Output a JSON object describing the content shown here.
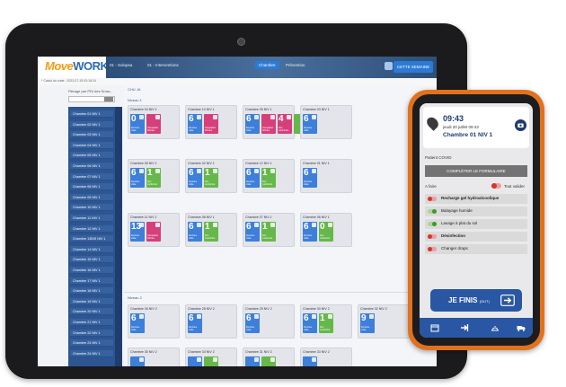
{
  "tablet": {
    "logo_move": "Move",
    "logo_work": "WORK",
    "logo_sub": "",
    "nav": [
      {
        "label": "01 - Solopsa"
      },
      {
        "label": "01 - Interventions"
      },
      {
        "label": "Chambre",
        "active": true
      },
      {
        "label": "Prévention"
      }
    ],
    "week_button": "CETTE SEMAINE",
    "calc_text": "* Calcul du cube : 2023-07-15 03:15:24",
    "filter_label": "Filtrage par PDI des Smar...",
    "sidebar_rooms": [
      "Chambre 01 NIV 1",
      "Chambre 02 NIV 1",
      "Chambre 03 NIV 1",
      "Chambre 04 NIV 1",
      "Chambre 05 NIV 1",
      "Chambre 06 NIV 1",
      "Chambre 07 NIV 1",
      "Chambre 08 NIV 1",
      "Chambre 09 NIV 1",
      "Chambre 10 NIV 1",
      "Chambre 11 NIV 1",
      "Chambre 12 NIV 1",
      "Chambre 13BIS NIV 1",
      "Chambre 14 NIV 1",
      "Chambre 15 NIV 1",
      "Chambre 16 NIV 1",
      "Chambre 17 NIV 1",
      "Chambre 18 NIV 1",
      "Chambre 19 NIV 1",
      "Chambre 20 NIV 1",
      "Chambre 21 NIV 1",
      "Chambre 22 NIV 1",
      "Chambre 23 NIV 1",
      "Chambre 24 NIV 1"
    ],
    "breadcrumb": "CHU JA",
    "niveau1": "Niveau 1",
    "niveau2": "Niveau 2",
    "cards": [
      {
        "title": "Chambre 04 NIV 1",
        "tiles": [
          {
            "n": "0",
            "c": "blue",
            "l": "Dernière visite"
          },
          {
            "n": "",
            "c": "pink",
            "l": "Occupation DirCare"
          }
        ]
      },
      {
        "title": "Chambre 10 NIV 1",
        "tiles": [
          {
            "n": "6",
            "c": "blue",
            "l": "Dernière visite"
          },
          {
            "n": "",
            "c": "pink",
            "l": "Occupation DirCare"
          }
        ]
      },
      {
        "title": "Chambre 05 NIV 1",
        "tiles": [
          {
            "n": "6",
            "c": "blue",
            "l": "Dernière visite"
          },
          {
            "n": "",
            "c": "pink",
            "l": "Occupation DirCare"
          },
          {
            "n": "4",
            "c": "pink",
            "l": "Non conformité"
          },
          {
            "n": "",
            "c": "green",
            "l": ""
          }
        ]
      },
      {
        "title": "Chambre 03 NIV 1",
        "tiles": [
          {
            "n": "6",
            "c": "blue",
            "l": "Dernière visite"
          }
        ]
      },
      {
        "title": "Chambre 05 NIV 1",
        "tiles": [
          {
            "n": "6",
            "c": "blue",
            "l": "Dernière visite"
          },
          {
            "n": "1",
            "c": "green",
            "l": "Non conformité"
          }
        ]
      },
      {
        "title": "Chambre 02 NIV 1",
        "tiles": [
          {
            "n": "6",
            "c": "blue",
            "l": "Dernière visite"
          },
          {
            "n": "1",
            "c": "green",
            "l": "Non conformité"
          }
        ]
      },
      {
        "title": "Chambre 12 NIV 1",
        "tiles": [
          {
            "n": "6",
            "c": "blue",
            "l": "Dernière visite"
          },
          {
            "n": "1",
            "c": "green",
            "l": "Non conformité"
          }
        ]
      },
      {
        "title": "Chambre 01 NIV 1",
        "tiles": [
          {
            "n": "6",
            "c": "blue",
            "l": "Dernière visite"
          }
        ]
      },
      {
        "title": "Chambre 11 NIV 1",
        "tiles": [
          {
            "n": "13",
            "c": "blue",
            "l": "Dernière visite"
          },
          {
            "n": "",
            "c": "pink",
            "l": "Occupation DirCare"
          }
        ]
      },
      {
        "title": "Chambre 08 NIV 1",
        "tiles": [
          {
            "n": "6",
            "c": "blue",
            "l": "Dernière visite"
          },
          {
            "n": "1",
            "c": "green",
            "l": "Non conformité"
          }
        ]
      },
      {
        "title": "Chambre 07 NIV 1",
        "tiles": [
          {
            "n": "6",
            "c": "blue",
            "l": "Dernière visite"
          },
          {
            "n": "1",
            "c": "green",
            "l": "Non conformité"
          }
        ]
      },
      {
        "title": "Chambre 06 NIV 1",
        "tiles": [
          {
            "n": "6",
            "c": "blue",
            "l": "Dernière visite"
          },
          {
            "n": "0",
            "c": "green",
            "l": "Non conformité"
          }
        ]
      },
      {
        "title": "Chambre 26 NIV 2",
        "tiles": [
          {
            "n": "6",
            "c": "blue",
            "l": "Dernière visite"
          }
        ]
      },
      {
        "title": "Chambre 28 NIV 2",
        "tiles": [
          {
            "n": "6",
            "c": "blue",
            "l": "Dernière visite"
          }
        ]
      },
      {
        "title": "Chambre 29 NIV 2",
        "tiles": [
          {
            "n": "6",
            "c": "blue",
            "l": "Dernière visite"
          }
        ]
      },
      {
        "title": "Chambre 30 NIV 2",
        "tiles": [
          {
            "n": "6",
            "c": "blue",
            "l": "Dernière visite"
          },
          {
            "n": "1",
            "c": "green",
            "l": "Non conformité"
          }
        ]
      },
      {
        "title": "Chambre 32 NIV 2",
        "tiles": [
          {
            "n": "9",
            "c": "blue",
            "l": "Dernière visite"
          }
        ]
      },
      {
        "title": "Chambre 35 NIV 2",
        "tiles": [
          {
            "n": "",
            "c": "blue",
            "l": ""
          }
        ]
      },
      {
        "title": "Chambre 34 NIV 2",
        "tiles": [
          {
            "n": "",
            "c": "blue",
            "l": ""
          },
          {
            "n": "",
            "c": "green",
            "l": ""
          }
        ]
      },
      {
        "title": "Chambre 31 NIV 2",
        "tiles": [
          {
            "n": "",
            "c": "blue",
            "l": ""
          },
          {
            "n": "",
            "c": "green",
            "l": ""
          }
        ]
      },
      {
        "title": "Chambre 33 NIV 2",
        "tiles": [
          {
            "n": "",
            "c": "blue",
            "l": ""
          }
        ]
      }
    ]
  },
  "phone": {
    "time": "09:43",
    "date": "jeudi 20 juillet 09:43",
    "room": "Chambre 01 NIV 1",
    "patient": "Patient COVID",
    "form_button": "COMPLÉTER LE FORMULAIRE",
    "todo_label": "A faire",
    "validate_all": "Tout valider",
    "tasks": [
      {
        "label": "Recharge gel hydroalcoolique",
        "done": false,
        "bold": true
      },
      {
        "label": "Balayage humide",
        "done": true,
        "bold": false
      },
      {
        "label": "Lavage à plat du sol",
        "done": true,
        "bold": false
      },
      {
        "label": "Désinfection",
        "done": false,
        "bold": true
      },
      {
        "label": "Changer draps",
        "done": false,
        "bold": false
      }
    ],
    "finish_label": "JE FINIS",
    "finish_sub": "(OUT)"
  }
}
